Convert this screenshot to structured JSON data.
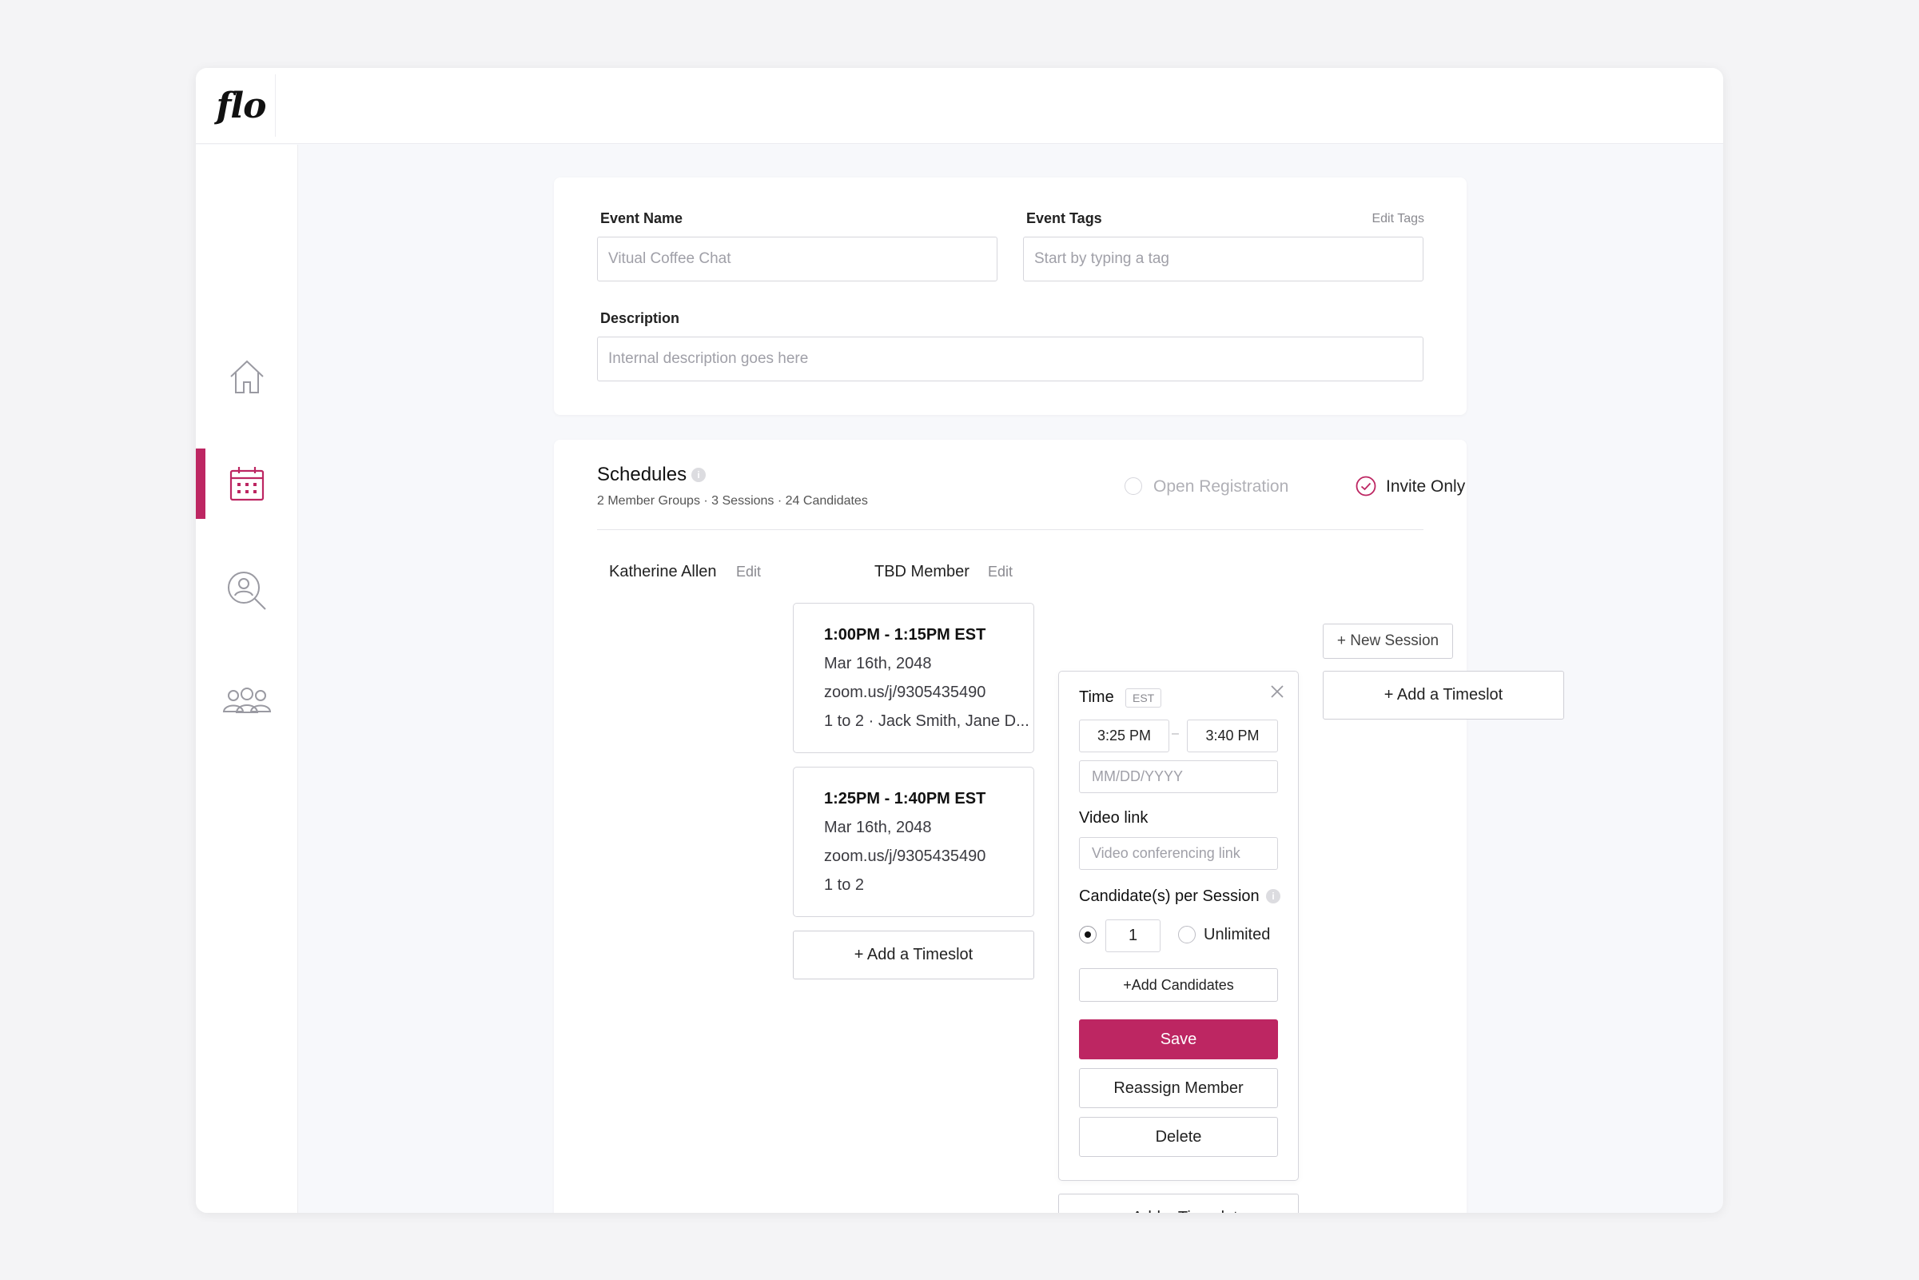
{
  "app": {
    "logo": "flo"
  },
  "nav": {
    "items": [
      {
        "name": "home",
        "icon": "home-icon"
      },
      {
        "name": "events",
        "icon": "calendar-icon",
        "active": true
      },
      {
        "name": "candidates",
        "icon": "person-search-icon"
      },
      {
        "name": "groups",
        "icon": "group-icon"
      }
    ]
  },
  "colors": {
    "accent": "#bd2662",
    "border": "#d6d6dc"
  },
  "event": {
    "name_label": "Event Name",
    "name_placeholder": "Vitual Coffee Chat",
    "tags_label": "Event Tags",
    "edit_tags": "Edit Tags",
    "tags_placeholder": "Start by typing a tag",
    "description_label": "Description",
    "description_placeholder": "Internal description goes here"
  },
  "schedules": {
    "title": "Schedules",
    "summary": "2 Member Groups · 3 Sessions · 24 Candidates",
    "open_registration": "Open Registration",
    "invite_only": "Invite Only",
    "columns": [
      {
        "member": "Katherine Allen",
        "edit": "Edit",
        "slots": [
          {
            "time": "1:00PM - 1:15PM EST",
            "date": "Mar 16th, 2048",
            "link": "zoom.us/j/9305435490",
            "detail": "1 to 2 · Jack Smith, Jane D..."
          },
          {
            "time": "1:25PM - 1:40PM EST",
            "date": "Mar 16th, 2048",
            "link": "zoom.us/j/9305435490",
            "detail": "1 to 2"
          }
        ],
        "add_timeslot": "+ Add a Timeslot"
      },
      {
        "member": "TBD Member",
        "edit": "Edit",
        "add_timeslot": "+ Add a Timeslot"
      },
      {
        "new_session": "+ New Session",
        "add_timeslot": "+ Add a Timeslot"
      }
    ],
    "editor": {
      "time_label": "Time",
      "tz": "EST",
      "start": "3:25 PM",
      "separator": "–",
      "end": "3:40 PM",
      "date_placeholder": "MM/DD/YYYY",
      "video_label": "Video link",
      "video_placeholder": "Video conferencing link",
      "candidates_label": "Candidate(s) per Session",
      "count": "1",
      "unlimited": "Unlimited",
      "add_candidates": "+Add Candidates",
      "save": "Save",
      "reassign": "Reassign Member",
      "delete": "Delete"
    }
  }
}
